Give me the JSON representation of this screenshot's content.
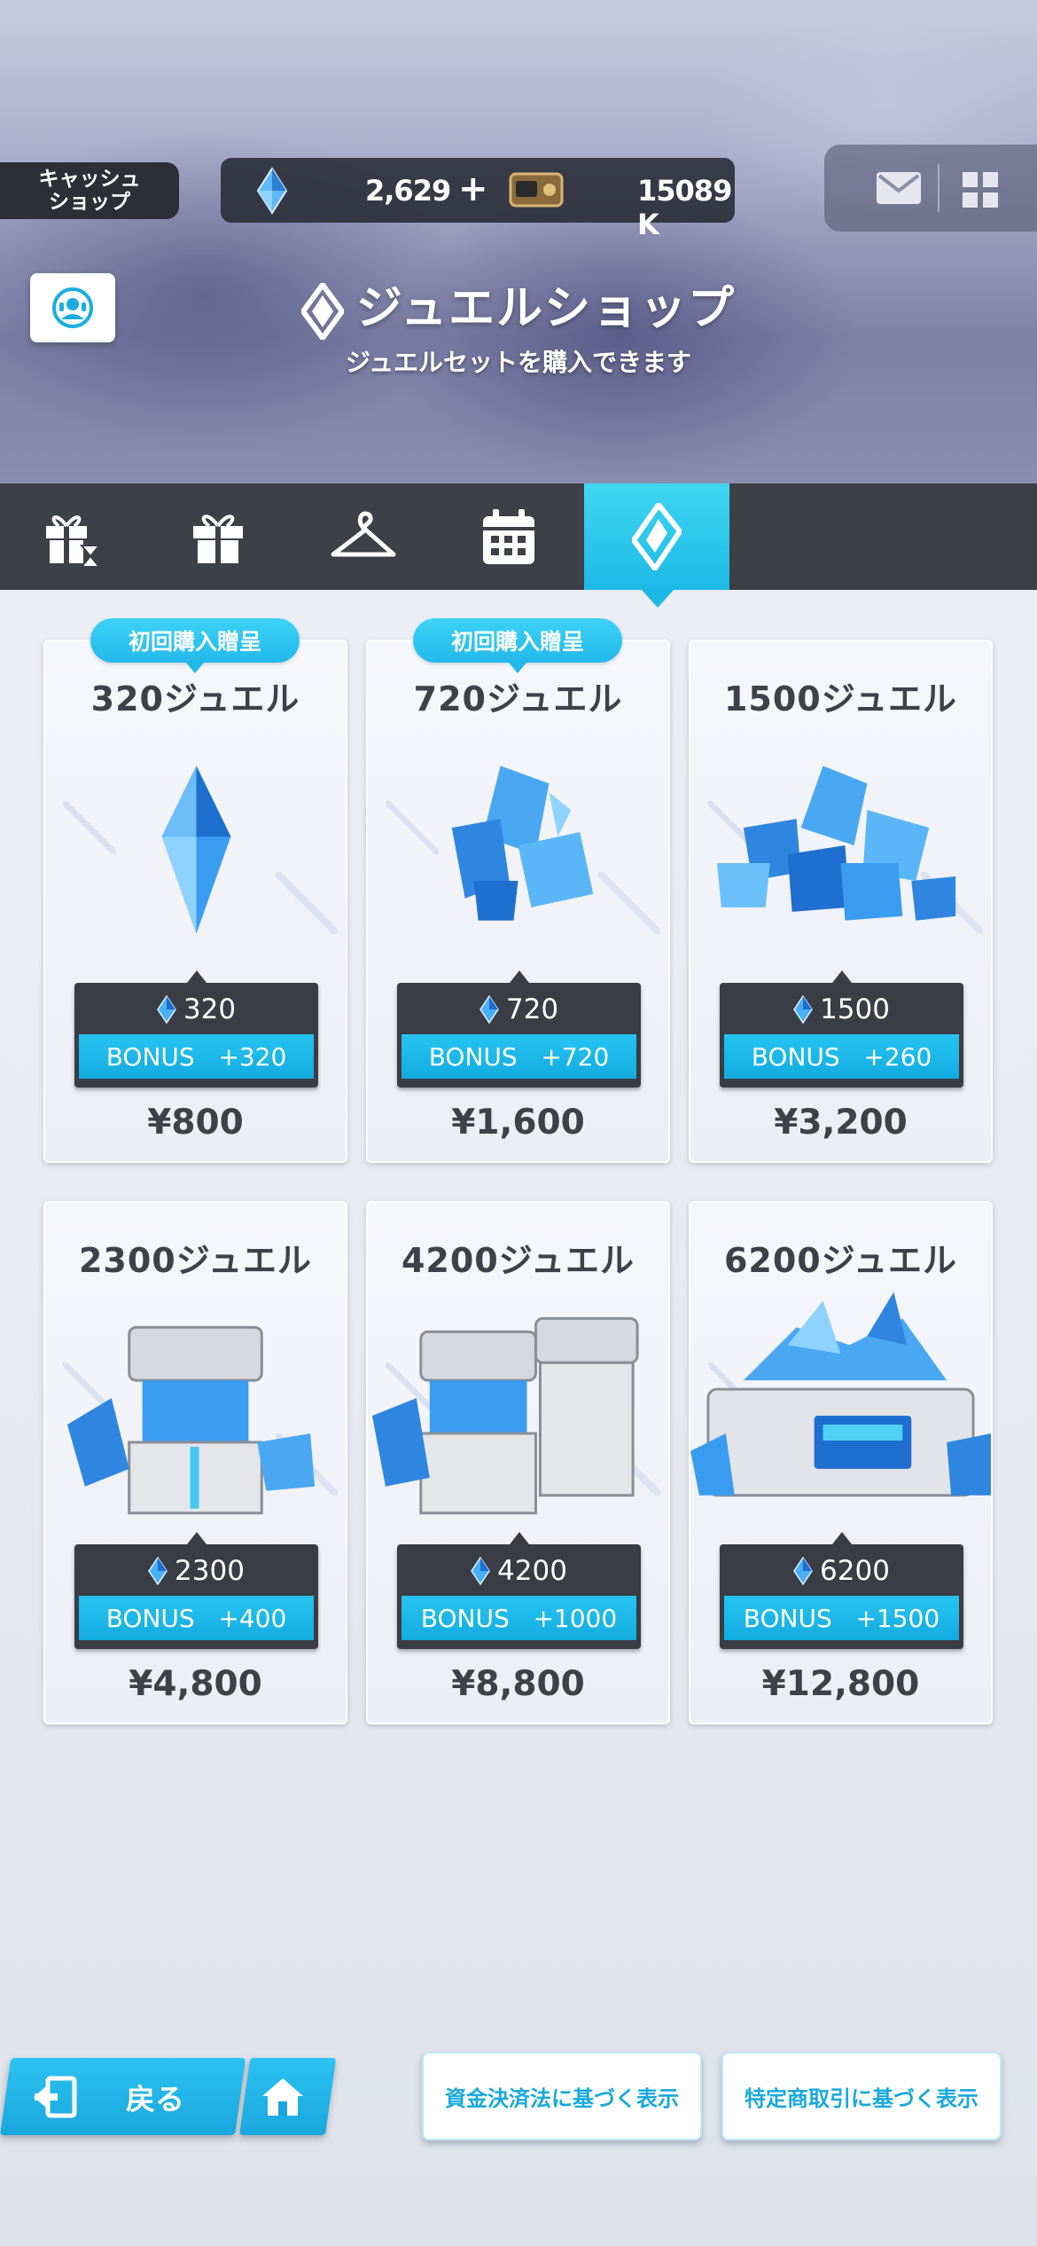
{
  "header": {
    "shop_tag": "キャッシュ\nショップ",
    "jewel_balance": "2,629",
    "plus_label": "+",
    "credit_balance": "15089 K",
    "page_title": "ジュエルショップ",
    "page_subtitle": "ジュエルセットを購入できます"
  },
  "tabs": [
    {
      "icon": "gift-timer-icon",
      "active": false
    },
    {
      "icon": "gift-icon",
      "active": false
    },
    {
      "icon": "hanger-icon",
      "active": false
    },
    {
      "icon": "calendar-icon",
      "active": false
    },
    {
      "icon": "jewel-icon",
      "active": true
    }
  ],
  "products": [
    {
      "title": "320ジュエル",
      "badge": "初回購入贈呈",
      "jewels": "320",
      "bonus": "BONUS   +320",
      "price": "¥800",
      "art": "single-crystal"
    },
    {
      "title": "720ジュエル",
      "badge": "初回購入贈呈",
      "jewels": "720",
      "bonus": "BONUS   +720",
      "price": "¥1,600",
      "art": "crystal-cluster-small"
    },
    {
      "title": "1500ジュエル",
      "badge": "",
      "jewels": "1500",
      "bonus": "BONUS   +260",
      "price": "¥3,200",
      "art": "crystal-pile"
    },
    {
      "title": "2300ジュエル",
      "badge": "",
      "jewels": "2300",
      "bonus": "BONUS   +400",
      "price": "¥4,800",
      "art": "crystal-container"
    },
    {
      "title": "4200ジュエル",
      "badge": "",
      "jewels": "4200",
      "bonus": "BONUS   +1000",
      "price": "¥8,800",
      "art": "double-container"
    },
    {
      "title": "6200ジュエル",
      "badge": "",
      "jewels": "6200",
      "bonus": "BONUS   +1500",
      "price": "¥12,800",
      "art": "crystal-chest"
    }
  ],
  "footer": {
    "back_label": "戻る",
    "legal_payment": "資金決済法に基づく表示",
    "legal_commerce": "特定商取引に基づく表示"
  },
  "colors": {
    "accent": "#1db9e6",
    "tabbar": "#3d4047",
    "card_dark": "#3a3d45"
  }
}
